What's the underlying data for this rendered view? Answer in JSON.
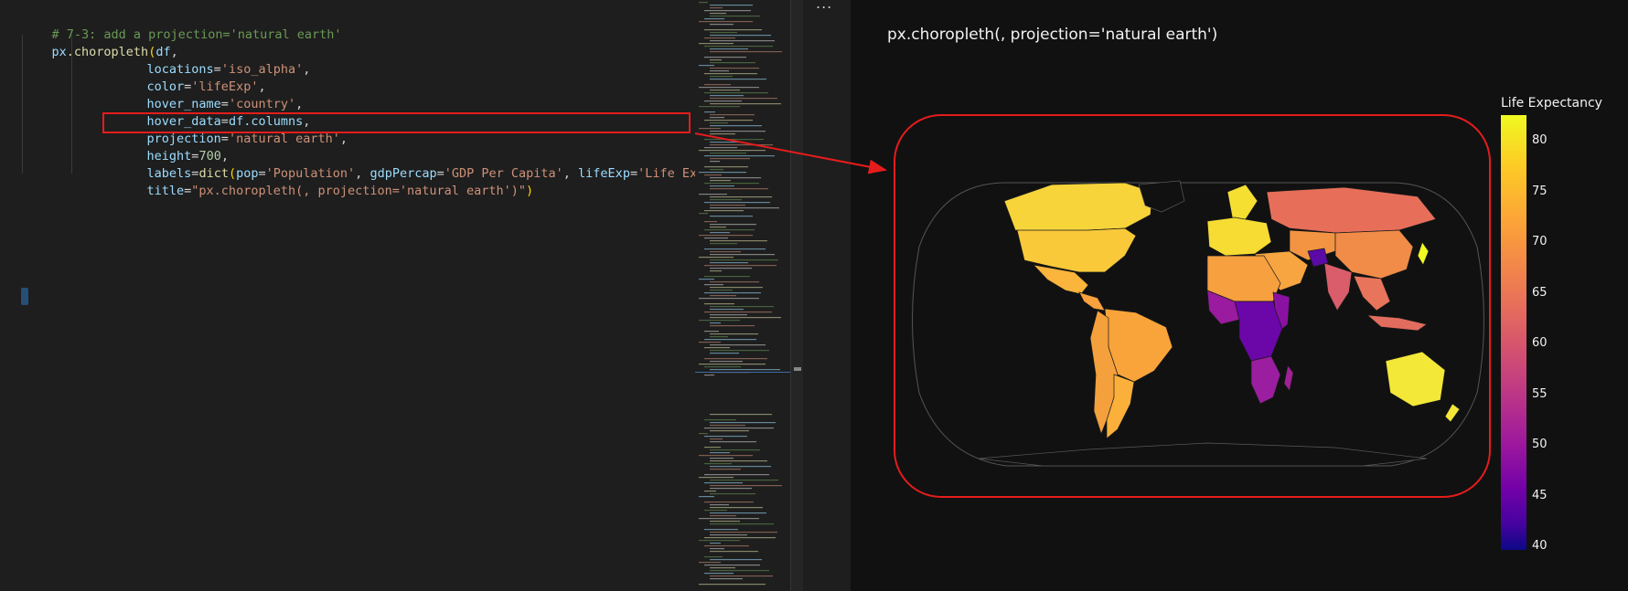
{
  "editor": {
    "lines": [
      {
        "comment": "# 7-3: add a projection='natural earth'"
      },
      {
        "func_obj": "px",
        "func_name": ".choropleth",
        "open": "(",
        "arg": "df",
        "sep": ","
      },
      {
        "key": "locations",
        "val": "'iso_alpha'",
        "sep": ","
      },
      {
        "key": "color",
        "val": "'lifeExp'",
        "sep": ","
      },
      {
        "key": "hover_name",
        "val": "'country'",
        "sep": ","
      },
      {
        "key": "hover_data",
        "val": "df.columns",
        "sep": ","
      },
      {
        "key": "projection",
        "val": "'natural earth'",
        "sep": ","
      },
      {
        "key": "height",
        "val": "700",
        "sep": ","
      },
      {
        "key": "labels",
        "func": "dict",
        "inner": [
          {
            "k": "pop",
            "v": "'Population'"
          },
          {
            "k": "gdpPercap",
            "v": "'GDP Per Capita'"
          },
          {
            "k": "lifeExp",
            "v": "'Life Expectancy"
          }
        ]
      },
      {
        "key": "title",
        "val": "\"px.choropleth(, projection='natural earth')\"",
        "close": ")"
      }
    ]
  },
  "output": {
    "more_icon": "...",
    "plot_title": "px.choropleth(, projection='natural earth')",
    "colorbar": {
      "title": "Life Expectancy",
      "ticks": [
        "80",
        "75",
        "70",
        "65",
        "60",
        "55",
        "50",
        "45",
        "40"
      ]
    }
  },
  "colors": {
    "highlight": "#e51c1c",
    "map_bg": "#111111"
  }
}
